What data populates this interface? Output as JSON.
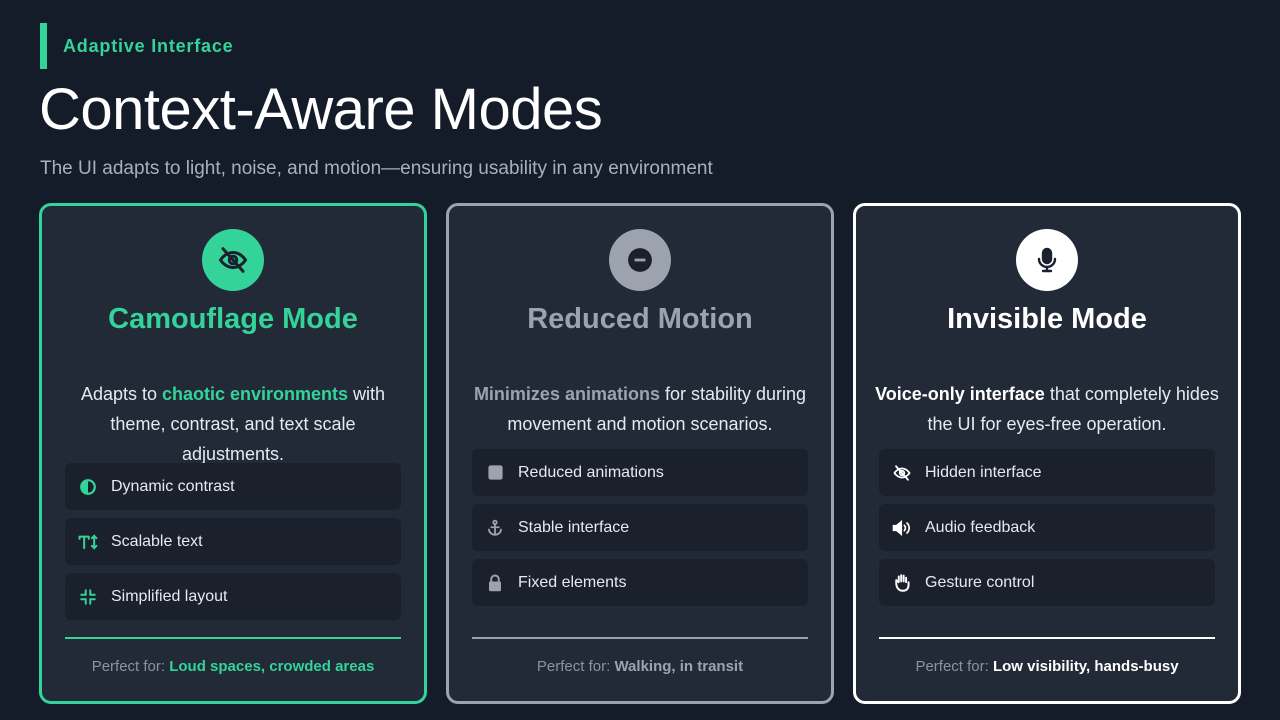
{
  "eyebrow": "Adaptive Interface",
  "title": "Context-Aware Modes",
  "subtitle": "The UI adapts to light, noise, and motion—ensuring usability in any environment",
  "colors": {
    "background": "#141b29",
    "card": "#222a37",
    "green": "#34d399",
    "gray": "#9ca3af",
    "white": "#ffffff"
  },
  "cards": [
    {
      "icon": "eye-slash-icon",
      "title": "Camouflage Mode",
      "desc_pre": "Adapts to ",
      "desc_highlight": "chaotic environments",
      "desc_post": " with theme, contrast, and text scale adjustments.",
      "features": [
        {
          "icon": "contrast-icon",
          "label": "Dynamic contrast"
        },
        {
          "icon": "text-height-icon",
          "label": "Scalable text"
        },
        {
          "icon": "compress-icon",
          "label": "Simplified layout"
        }
      ],
      "footer_prefix": "Perfect for: ",
      "footer_value": "Loud spaces, crowded areas"
    },
    {
      "icon": "pause-circle-icon",
      "title": "Reduced Motion",
      "desc_pre": "",
      "desc_highlight": "Minimizes animations",
      "desc_post": " for stability during movement and motion scenarios.",
      "features": [
        {
          "icon": "square-icon",
          "label": "Reduced animations"
        },
        {
          "icon": "anchor-icon",
          "label": "Stable interface"
        },
        {
          "icon": "lock-icon",
          "label": "Fixed elements"
        }
      ],
      "footer_prefix": "Perfect for: ",
      "footer_value": "Walking, in transit"
    },
    {
      "icon": "microphone-icon",
      "title": "Invisible Mode",
      "desc_pre": "",
      "desc_highlight": "Voice-only interface",
      "desc_post": " that completely hides the UI for eyes-free operation.",
      "features": [
        {
          "icon": "eye-slash-icon",
          "label": "Hidden interface"
        },
        {
          "icon": "volume-icon",
          "label": "Audio feedback"
        },
        {
          "icon": "hand-icon",
          "label": "Gesture control"
        }
      ],
      "footer_prefix": "Perfect for: ",
      "footer_value": "Low visibility, hands-busy"
    }
  ]
}
